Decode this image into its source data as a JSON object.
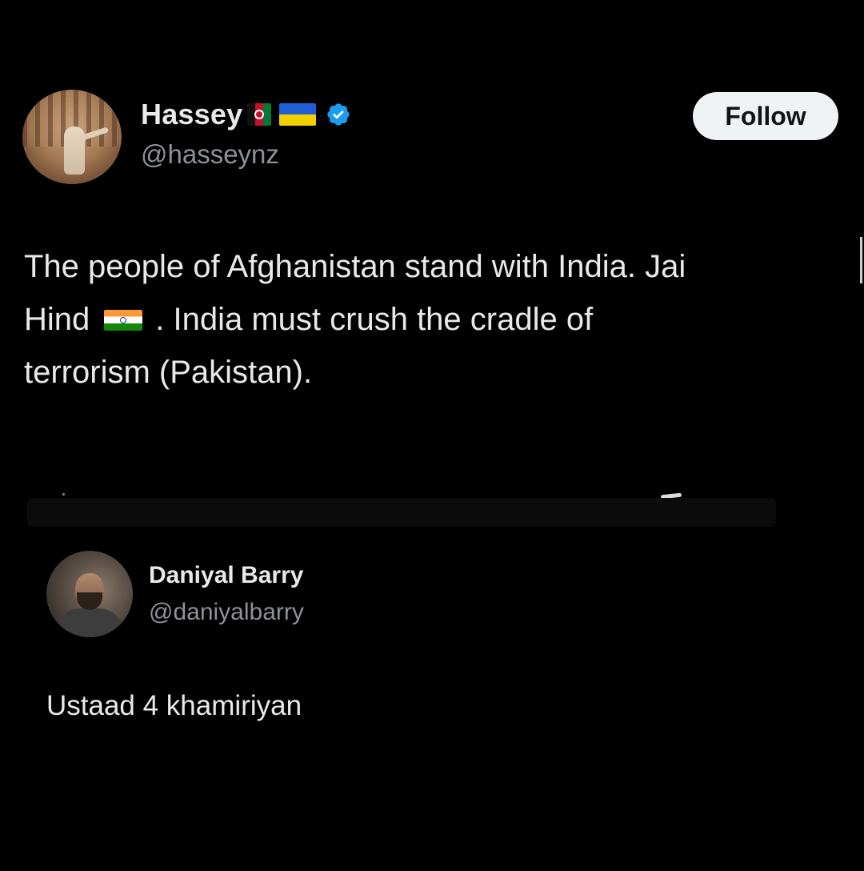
{
  "main_tweet": {
    "display_name": "Hassey",
    "handle": "@hasseynz",
    "flags": [
      "afghanistan-flag",
      "ukraine-flag"
    ],
    "verified": true,
    "follow_label": "Follow",
    "text_lines": [
      "The people of Afghanistan stand with India. Jai",
      ". India must crush the cradle of",
      "terrorism (Pakistan)."
    ],
    "text_line2_prefix": "Hind",
    "inline_flag": "india-flag"
  },
  "reply": {
    "display_name": "Daniyal Barry",
    "handle": "@daniyalbarry",
    "text": "Ustaad 4 khamiriyan"
  },
  "colors": {
    "background": "#000000",
    "primary_text": "#e7e9ea",
    "secondary_text": "#8b9299",
    "follow_button_bg": "#eff3f4",
    "verified_blue": "#1d9bf0"
  }
}
